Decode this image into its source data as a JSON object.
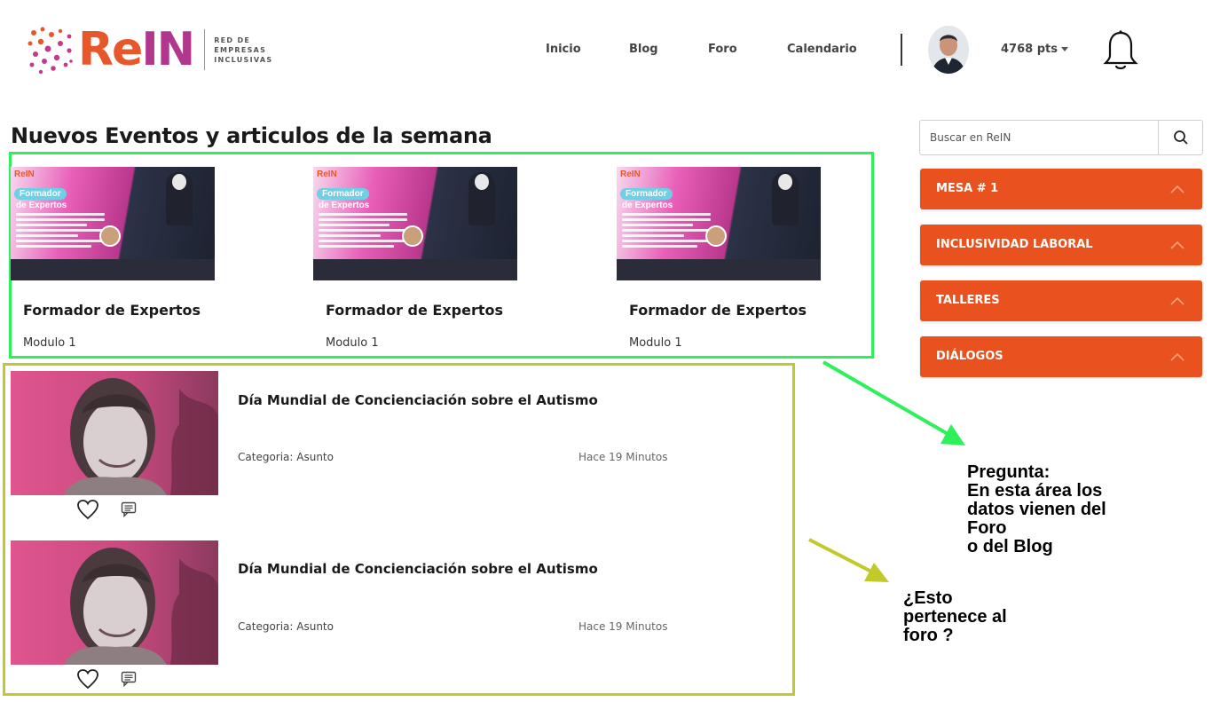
{
  "header": {
    "logo": {
      "text_re": "Re",
      "text_in": "IN",
      "tagline": [
        "RED DE",
        "EMPRESAS",
        "INCLUSIVAS"
      ],
      "colors": {
        "orange": "#e8572a",
        "magenta": "#b0368e"
      }
    },
    "nav": [
      "Inicio",
      "Blog",
      "Foro",
      "Calendario"
    ],
    "user": {
      "avatar": "user-avatar",
      "points": "4768 pts"
    },
    "notifications_icon": "bell-icon"
  },
  "main": {
    "title": "Nuevos Eventos y articulos de la semana",
    "events": [
      {
        "title": "Formador de Expertos",
        "subtitle": "Modulo 1",
        "thumb": {
          "logo": "ReIN",
          "badge": "Formador",
          "heading": "de Expertos"
        }
      },
      {
        "title": "Formador de Expertos",
        "subtitle": "Modulo 1",
        "thumb": {
          "logo": "ReIN",
          "badge": "Formador",
          "heading": "de Expertos"
        }
      },
      {
        "title": "Formador de Expertos",
        "subtitle": "Modulo 1",
        "thumb": {
          "logo": "ReIN",
          "badge": "Formador",
          "heading": "de Expertos"
        }
      }
    ],
    "posts": [
      {
        "title": "Día Mundial de Concienciación sobre el Autismo",
        "category": "Categoria: Asunto",
        "time": "Hace 19 Minutos"
      },
      {
        "title": "Día Mundial de Concienciación sobre el Autismo",
        "category": "Categoria: Asunto",
        "time": "Hace 19 Minutos"
      }
    ]
  },
  "sidebar": {
    "search_placeholder": "Buscar en ReIN",
    "accordions": [
      "MESA # 1",
      "INCLUSIVIDAD LABORAL",
      "TALLERES",
      "DIÁLOGOS"
    ],
    "accent": "#e9521f"
  },
  "annotations": {
    "green_note": [
      "Pregunta:",
      "En esta área los",
      "datos vienen del",
      "Foro",
      "o del Blog"
    ],
    "yellow_note": [
      "¿Esto",
      "pertenece al",
      "foro ?"
    ],
    "colors": {
      "green": "#2ef05a",
      "yellow": "#c2c92b"
    }
  }
}
